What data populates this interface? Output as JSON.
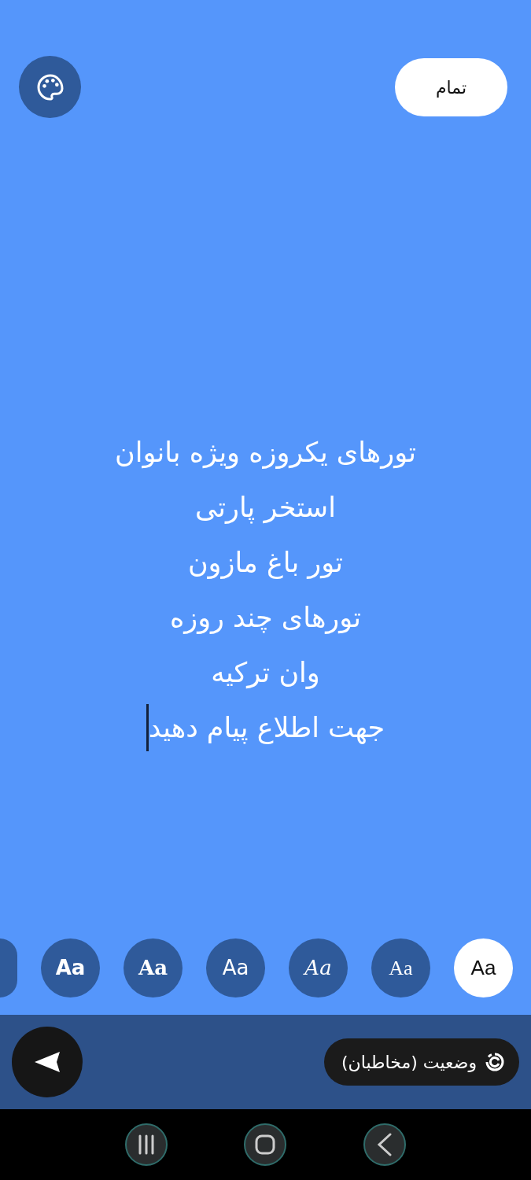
{
  "top_bar": {
    "done_button": "تمام"
  },
  "status_text": {
    "lines": [
      "تورهای یکروزه ویژه بانوان",
      "استخر پارتی",
      "تور باغ مازون",
      "تورهای چند روزه",
      "وان ترکیه",
      "جهت اطلاع پیام دهید"
    ]
  },
  "font_options": [
    {
      "label": "Aa",
      "kind": "sans",
      "selected": true
    },
    {
      "label": "Aa",
      "kind": "serif",
      "selected": false
    },
    {
      "label": "Aa",
      "kind": "italic",
      "selected": false
    },
    {
      "label": "Aa",
      "kind": "rounded",
      "selected": false
    },
    {
      "label": "Aa",
      "kind": "slab",
      "selected": false
    },
    {
      "label": "Aa",
      "kind": "heavy",
      "selected": false
    },
    {
      "kind": "cut",
      "selected": false
    }
  ],
  "bottom_bar": {
    "audience": "وضعیت (مخاطبان)"
  }
}
